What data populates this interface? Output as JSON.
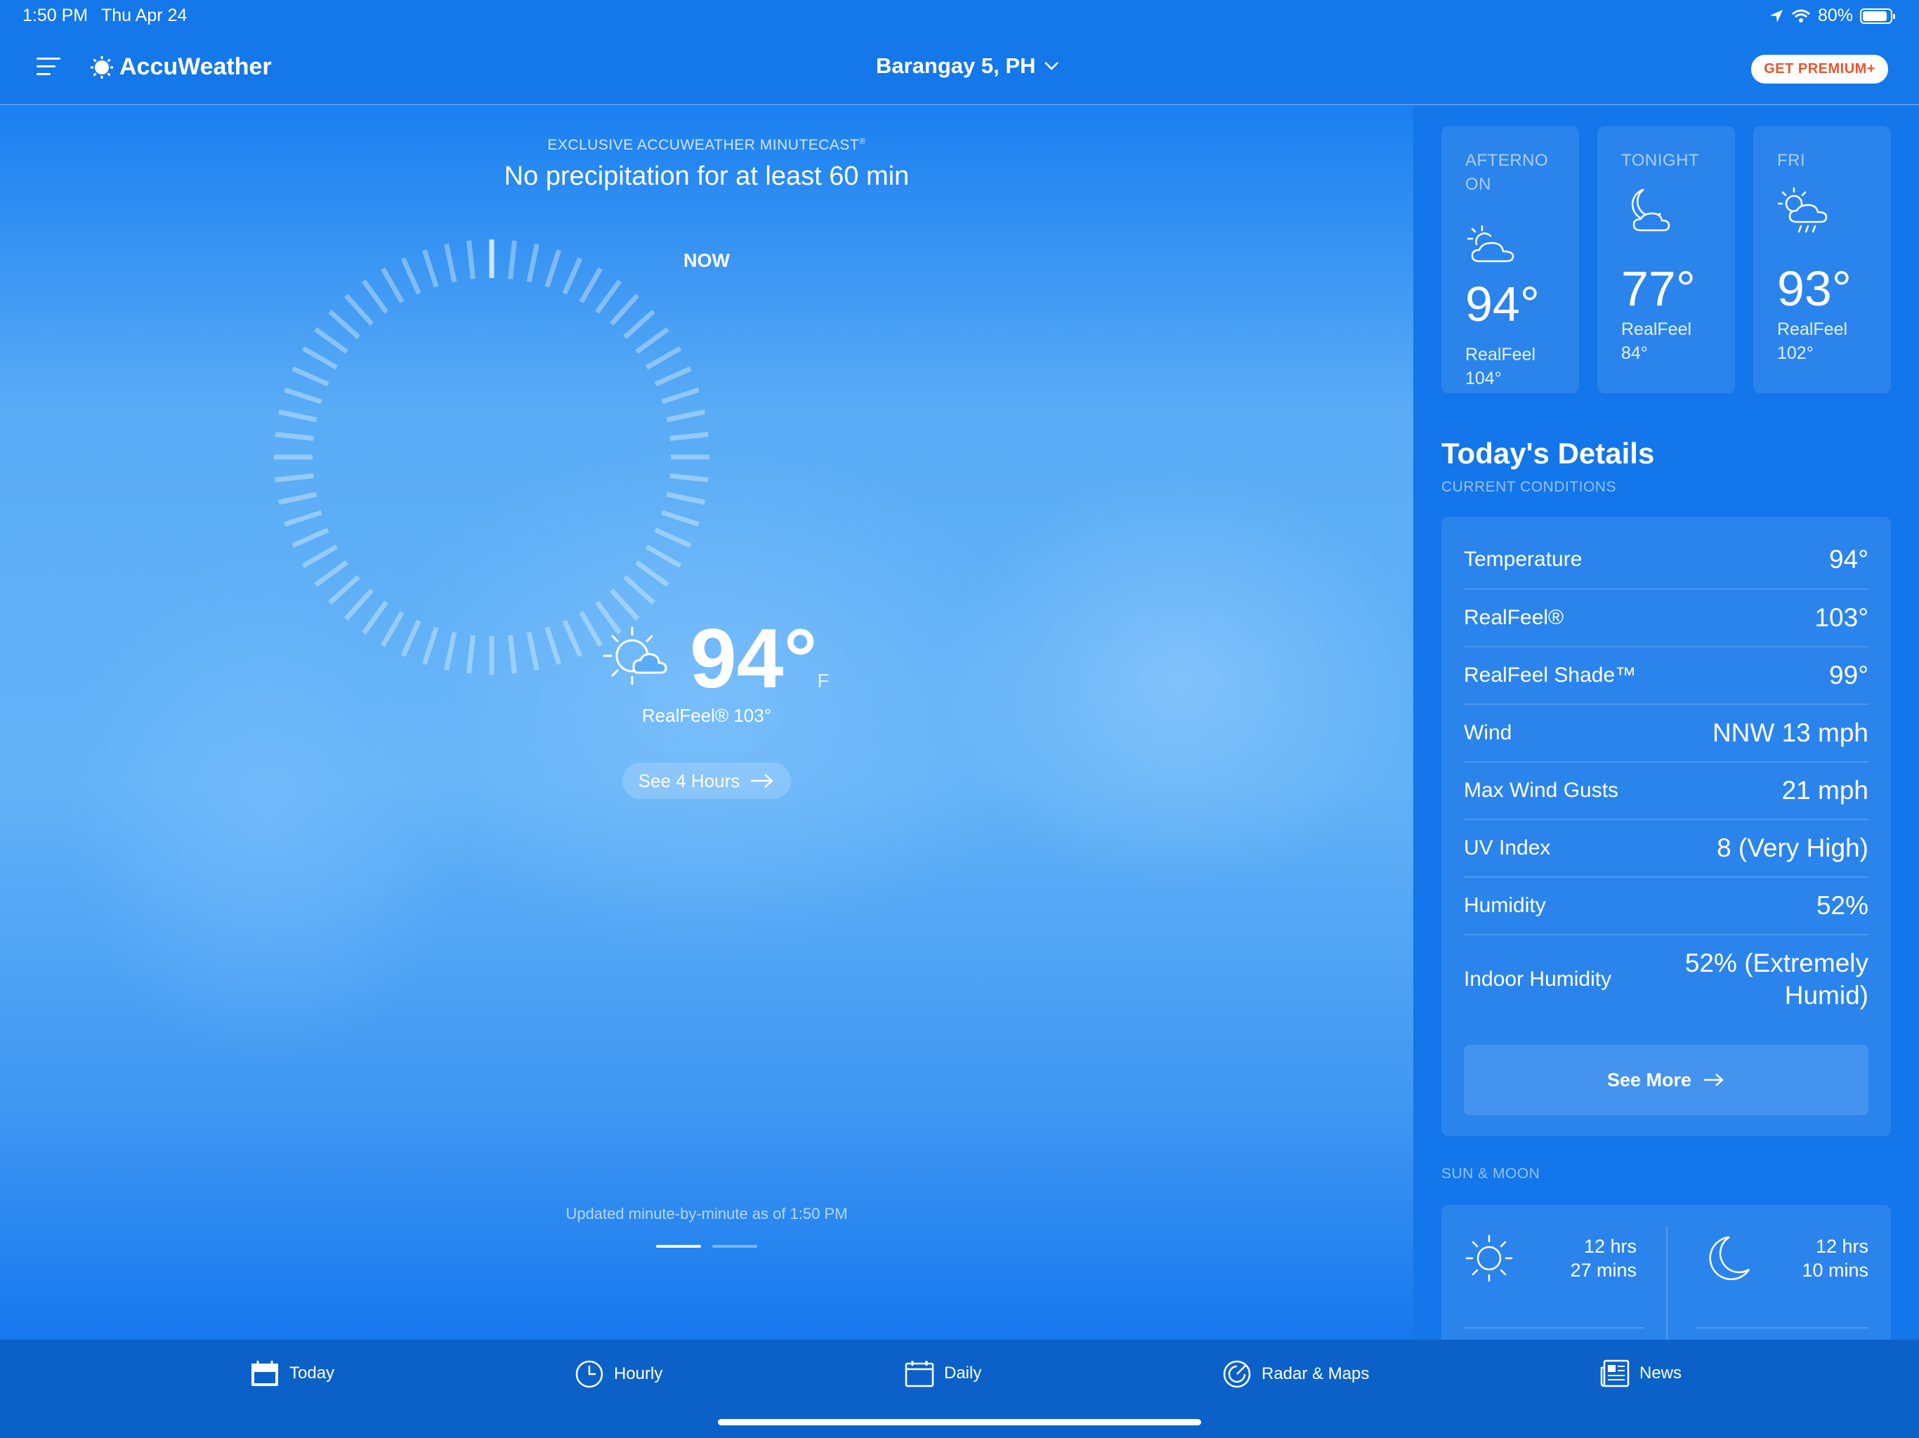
{
  "status_bar": {
    "time": "1:50 PM",
    "date": "Thu Apr 24",
    "battery": "80%"
  },
  "header": {
    "app_name": "AccuWeather",
    "location": "Barangay 5, PH",
    "premium_label": "GET PREMIUM+"
  },
  "minutecast": {
    "label": "EXCLUSIVE ACCUWEATHER MINUTECAST",
    "label_mark": "®",
    "summary": "No precipitation for at least 60 min",
    "now_label": "NOW",
    "updated": "Updated minute-by-minute as of 1:50 PM",
    "page_count": 2,
    "active_page": 1
  },
  "current": {
    "temp": "94°",
    "unit": "F",
    "realfeel": "RealFeel® 103°",
    "icon": "partly-sunny-icon",
    "see_hours": "See 4 Hours"
  },
  "forecast": [
    {
      "period": "AFTERNO ON",
      "temp": "94°",
      "realfeel_label": "RealFeel",
      "realfeel": "104°",
      "icon": "partly-cloudy-day-icon"
    },
    {
      "period": "TONIGHT",
      "temp": "77°",
      "realfeel_label": "RealFeel",
      "realfeel": "84°",
      "icon": "partly-cloudy-night-icon"
    },
    {
      "period": "FRI",
      "temp": "93°",
      "realfeel_label": "RealFeel",
      "realfeel": "102°",
      "icon": "sun-cloud-rain-icon"
    }
  ],
  "details": {
    "title": "Today's Details",
    "subtitle": "CURRENT CONDITIONS",
    "rows": [
      {
        "label": "Temperature",
        "value": "94°"
      },
      {
        "label": "RealFeel®",
        "value": "103°"
      },
      {
        "label": "RealFeel Shade™",
        "value": "99°"
      },
      {
        "label": "Wind",
        "value": "NNW 13 mph"
      },
      {
        "label": "Max Wind Gusts",
        "value": "21 mph"
      },
      {
        "label": "UV Index",
        "value": "8 (Very High)"
      },
      {
        "label": "Humidity",
        "value": "52%"
      },
      {
        "label": "Indoor Humidity",
        "value": "52% (Extremely Humid)"
      }
    ],
    "see_more": "See More"
  },
  "sun_moon": {
    "label": "SUN & MOON",
    "sun": {
      "line1": "12 hrs",
      "line2": "27 mins"
    },
    "moon": {
      "line1": "12 hrs",
      "line2": "10 mins"
    }
  },
  "tabs": [
    {
      "label": "Today",
      "icon": "calendar-day-icon"
    },
    {
      "label": "Hourly",
      "icon": "clock-icon"
    },
    {
      "label": "Daily",
      "icon": "calendar-icon"
    },
    {
      "label": "Radar & Maps",
      "icon": "radar-icon"
    },
    {
      "label": "News",
      "icon": "newspaper-icon"
    }
  ],
  "colors": {
    "background": "#1477ea",
    "tab_bar": "#0c61c8",
    "premium_text": "#e8562b"
  }
}
